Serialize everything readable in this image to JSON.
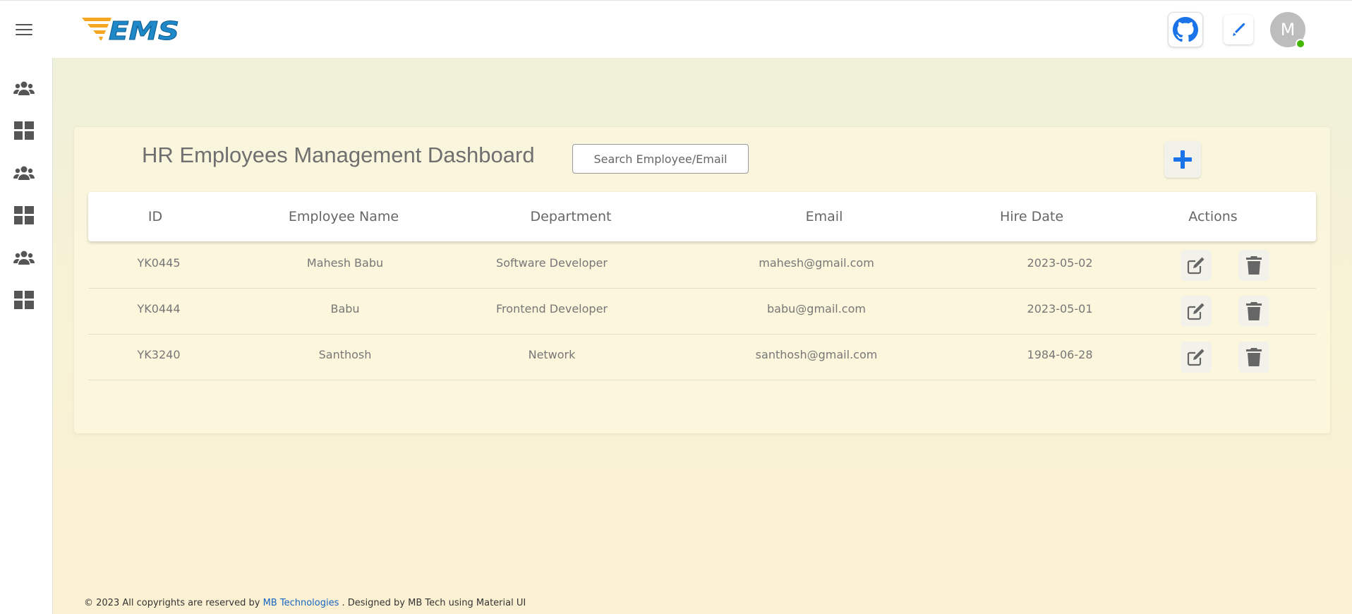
{
  "app": {
    "logo_text": "EMS"
  },
  "topbar": {
    "avatar_initial": "M"
  },
  "sidebar": {
    "items": [
      {
        "icon": "users-icon"
      },
      {
        "icon": "dashboard-icon"
      },
      {
        "icon": "users-icon"
      },
      {
        "icon": "dashboard-icon"
      },
      {
        "icon": "users-icon"
      },
      {
        "icon": "dashboard-icon"
      }
    ]
  },
  "dashboard": {
    "title": "HR Employees Management Dashboard",
    "search_placeholder": "Search Employee/Email",
    "columns": [
      "ID",
      "Employee Name",
      "Department",
      "Email",
      "Hire Date",
      "Actions"
    ],
    "rows": [
      {
        "id": "YK0445",
        "name": "Mahesh Babu",
        "department": "Software Developer",
        "email": "mahesh@gmail.com",
        "hire_date": "2023-05-02"
      },
      {
        "id": "YK0444",
        "name": "Babu",
        "department": "Frontend Developer",
        "email": "babu@gmail.com",
        "hire_date": "2023-05-01"
      },
      {
        "id": "YK3240",
        "name": "Santhosh",
        "department": "Network",
        "email": "santhosh@gmail.com",
        "hire_date": "1984-06-28"
      }
    ]
  },
  "footer": {
    "prefix": "© 2023 All copyrights are reserved by",
    "link": "MB Technologies",
    "suffix": ". Designed by MB Tech using Material UI"
  },
  "colors": {
    "accent": "#1a73e8",
    "online": "#44b700",
    "icon": "#555555"
  }
}
